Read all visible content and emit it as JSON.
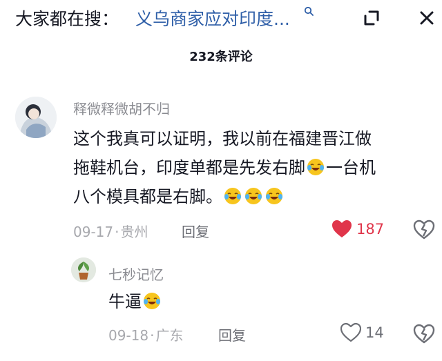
{
  "header": {
    "search_prefix": "大家都在搜：",
    "search_query": "义乌商家应对印度...",
    "collapse_icon": "collapse-icon",
    "close_icon": "close-icon"
  },
  "comments_count_title": "232条评论",
  "comment": {
    "username": "释微释微胡不归",
    "text_lines": [
      "这个我真可以证明，我以前在福建晋江做",
      "拖鞋机台，印度单都是先发右脚",
      "一台机",
      "八个模具都是右脚。"
    ],
    "date": "09-17",
    "location": "贵州",
    "reply_label": "回复",
    "likes": "187",
    "liked": true
  },
  "reply": {
    "username": "七秒记忆",
    "text": "牛逼",
    "date": "09-18",
    "location": "广东",
    "reply_label": "回复",
    "likes": "14",
    "liked": false
  },
  "colors": {
    "accent_link": "#2f5fa8",
    "like_red": "#e0354a",
    "muted_text": "#a7a8ad",
    "primary_text": "#161823"
  },
  "icons": [
    "search-icon",
    "collapse-icon",
    "close-icon",
    "heart-icon",
    "dislike-icon",
    "laughing-crying-emoji"
  ]
}
